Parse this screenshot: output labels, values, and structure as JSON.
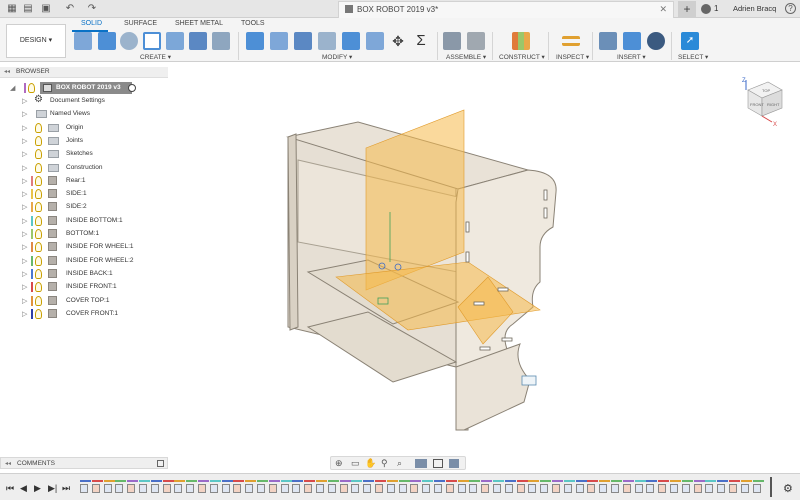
{
  "app": {
    "document_title": "BOX ROBOT 2019 v3*",
    "notification_count": "1",
    "user_name": "Adrien Bracq"
  },
  "ribbon": {
    "workspace": "DESIGN",
    "tabs": [
      "SOLID",
      "SURFACE",
      "SHEET METAL",
      "TOOLS"
    ],
    "active_tab": "SOLID",
    "groups": [
      "CREATE",
      "MODIFY",
      "ASSEMBLE",
      "CONSTRUCT",
      "INSPECT",
      "INSERT",
      "SELECT"
    ]
  },
  "browser": {
    "header": "BROWSER",
    "root": "BOX ROBOT 2019 v3",
    "items": [
      {
        "label": "Document Settings",
        "type": "settings"
      },
      {
        "label": "Named Views",
        "type": "folder"
      },
      {
        "label": "Origin",
        "type": "folder"
      },
      {
        "label": "Joints",
        "type": "folder"
      },
      {
        "label": "Sketches",
        "type": "folder"
      },
      {
        "label": "Construction",
        "type": "folder"
      },
      {
        "label": "Rear:1",
        "type": "part",
        "color": "#e07b7b"
      },
      {
        "label": "SIDE:1",
        "type": "part",
        "color": "#e8c34a"
      },
      {
        "label": "SIDE:2",
        "type": "part",
        "color": "#e8a84a"
      },
      {
        "label": "INSIDE BOTTOM:1",
        "type": "part",
        "color": "#5bc6c6"
      },
      {
        "label": "BOTTOM:1",
        "type": "part",
        "color": "#9ac76a"
      },
      {
        "label": "INSIDE FOR WHEEL:1",
        "type": "part",
        "color": "#e08a45"
      },
      {
        "label": "INSIDE FOR WHEEL:2",
        "type": "part",
        "color": "#66b86a"
      },
      {
        "label": "INSIDE BACK:1",
        "type": "part",
        "color": "#4a78d0"
      },
      {
        "label": "INSIDE FRONT:1",
        "type": "part",
        "color": "#d84a4a"
      },
      {
        "label": "COVER TOP:1",
        "type": "part",
        "color": "#e0923a"
      },
      {
        "label": "COVER FRONT:1",
        "type": "part",
        "color": "#2e3fa8"
      }
    ]
  },
  "viewcube": {
    "top": "TOP",
    "front": "FRONT",
    "right": "RIGHT"
  },
  "comments": {
    "label": "COMMENTS"
  },
  "colors": {
    "accent": "#0a72c6",
    "part_fill": "#ede6dc",
    "plane": "#f5b94a"
  }
}
